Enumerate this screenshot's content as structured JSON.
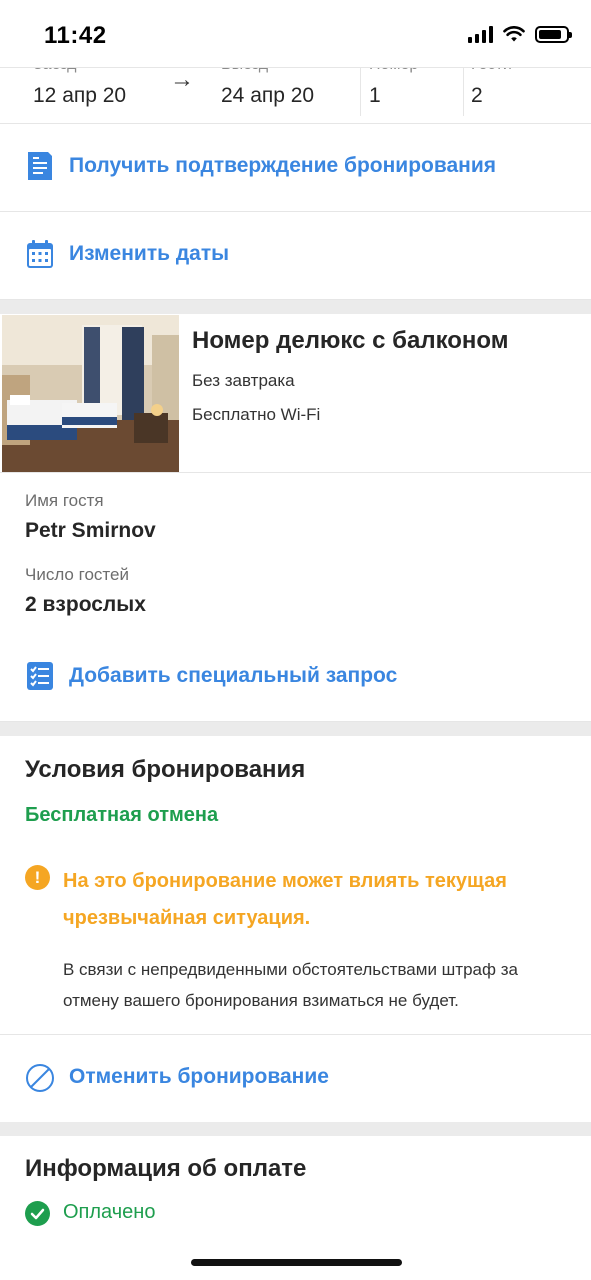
{
  "status_bar": {
    "time": "11:42"
  },
  "dates": {
    "checkin_label": "Заезд",
    "checkin_value": "12 апр 20",
    "checkout_label": "Выезд",
    "checkout_value": "24 апр 20",
    "rooms_label": "Номер",
    "rooms_value": "1",
    "guests_label": "Гости",
    "guests_value": "2"
  },
  "actions": {
    "confirm_label": "Получить подтверждение бронирования",
    "change_dates_label": "Изменить даты",
    "special_request_label": "Добавить специальный запрос",
    "cancel_label": "Отменить бронирование"
  },
  "room": {
    "title": "Номер делюкс с балконом",
    "meal": "Без завтрака",
    "wifi": "Бесплатно Wi-Fi"
  },
  "guest": {
    "name_label": "Имя гостя",
    "name_value": "Petr Smirnov",
    "count_label": "Число гостей",
    "count_value": "2 взрослых"
  },
  "conditions": {
    "title": "Условия бронирования",
    "free_cancel": "Бесплатная отмена",
    "warning": "На это бронирование может влиять текущая чрезвычайная ситуация.",
    "note": "В связи с непредвиденными обстоятельствами штраф за отмену вашего бронирования взиматься не будет."
  },
  "payment": {
    "title": "Информация об оплате",
    "status": "Оплачено"
  },
  "colors": {
    "accent_blue": "#3a86e0",
    "success_green": "#1e9e4e",
    "warning_orange": "#f5a623"
  }
}
